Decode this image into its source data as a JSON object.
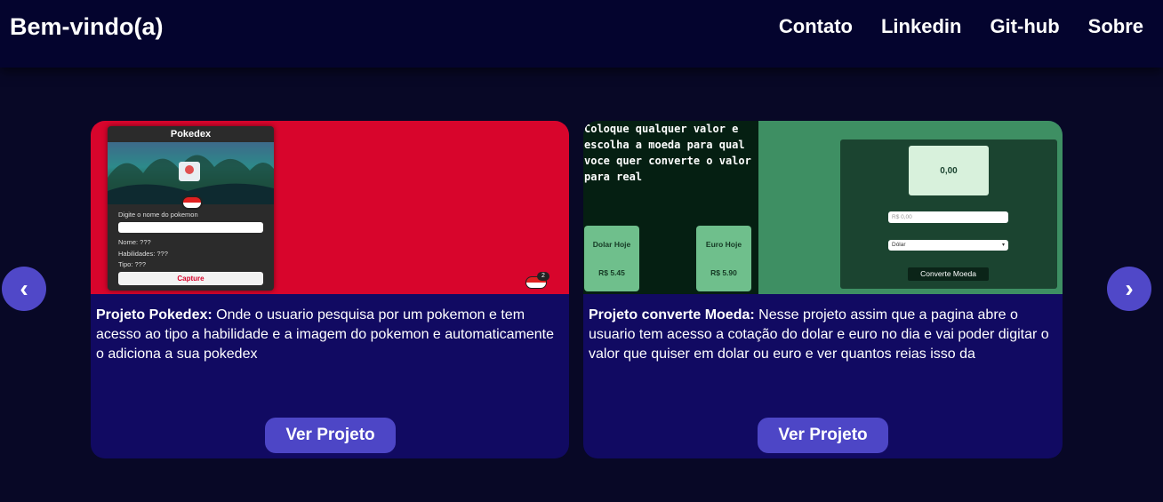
{
  "header": {
    "brand": "Bem-vindo(a)",
    "nav": [
      "Contato",
      "Linkedin",
      "Git-hub",
      "Sobre"
    ]
  },
  "carousel": {
    "prev_symbol": "‹",
    "next_symbol": "›"
  },
  "cards": [
    {
      "title": "Projeto Pokedex:",
      "description": " Onde o usuario pesquisa por um pokemon e tem acesso ao tipo a habilidade e a imagem do pokemon e automaticamente o adiciona a sua pokedex",
      "button": "Ver Projeto",
      "thumb": {
        "app_title": "Pokedex",
        "prompt": "Digite o nome do pokemon",
        "nome": "Nome:  ???",
        "habilidades": "Habilidades:  ???",
        "tipo": "Tipo:  ???",
        "capture": "Capture",
        "badge_count": "2"
      }
    },
    {
      "title": "Projeto converte Moeda:",
      "description": " Nesse projeto assim que a pagina abre o usuario tem acesso a cotação do dolar e euro no dia e vai poder digitar o valor que quiser em dolar ou euro e ver quantos reias isso da",
      "button": "Ver Projeto",
      "thumb": {
        "intro": "Coloque qualquer valor e escolha a moeda para qual voce quer converte o valor para real",
        "dolar_label": "Dolar Hoje",
        "dolar_value": "R$ 5.45",
        "euro_label": "Euro Hoje",
        "euro_value": "R$ 5.90",
        "result": "0,00",
        "input_placeholder": "R$ 0,00",
        "select_value": "Dólar",
        "convert_button": "Converte Moeda"
      }
    }
  ],
  "colors": {
    "background": "#080826",
    "header": "#04042e",
    "card": "#110a62",
    "button": "#4d46c6",
    "pokedex_red": "#d8052c",
    "moeda_green": "#3e8f63"
  }
}
